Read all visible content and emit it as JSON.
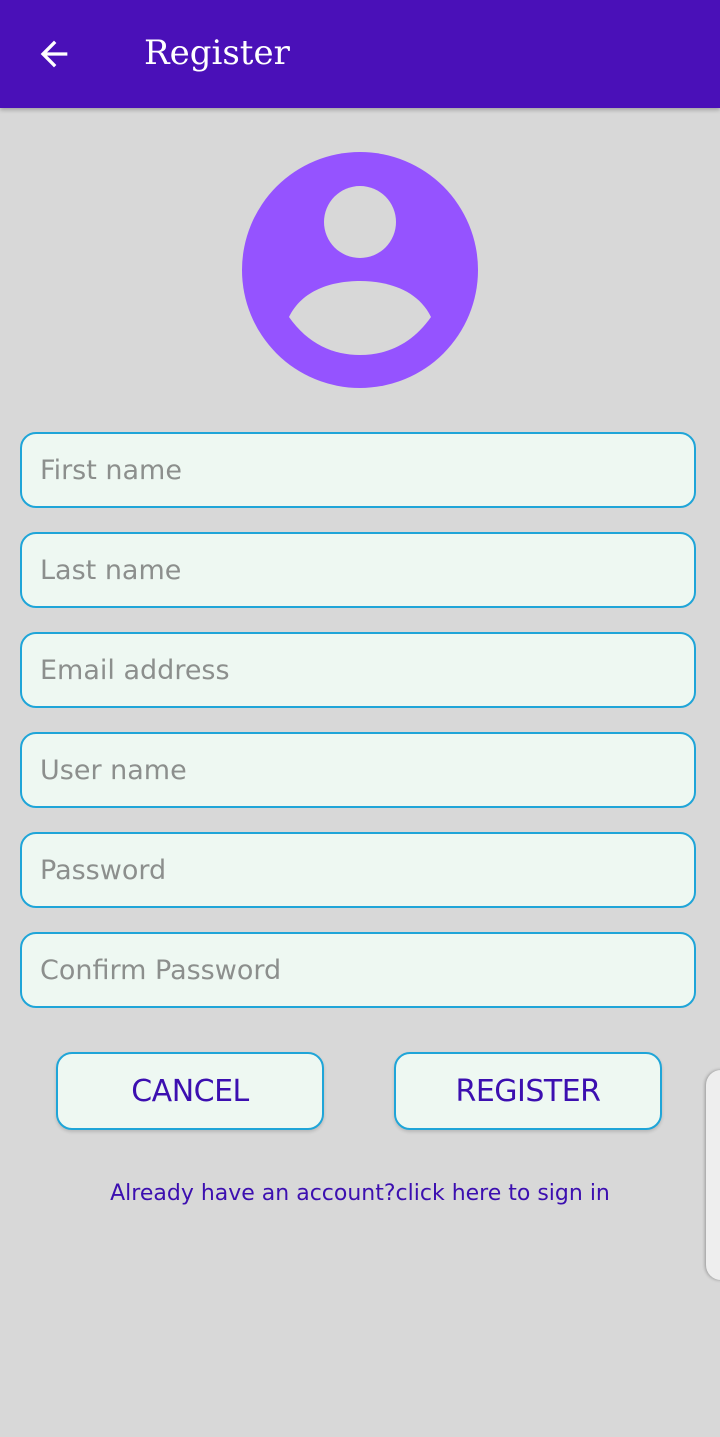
{
  "header": {
    "title": "Register",
    "back_icon": "arrow-left-icon",
    "background": "#4a10b8"
  },
  "avatar": {
    "icon": "user-profile-icon",
    "color": "#9553ff"
  },
  "form": {
    "first_name_placeholder": "First name",
    "last_name_placeholder": "Last name",
    "email_placeholder": "Email address",
    "username_placeholder": "User name",
    "password_placeholder": "Password",
    "confirm_password_placeholder": "Confirm Password"
  },
  "buttons": {
    "cancel_label": "CANCEL",
    "register_label": "REGISTER"
  },
  "signin_link": "Already have an account?click here to sign in",
  "colors": {
    "accent": "#3c0fb0",
    "field_border": "#1fa5d8",
    "field_bg": "#eef8f2",
    "page_bg": "#d8d8d8"
  }
}
